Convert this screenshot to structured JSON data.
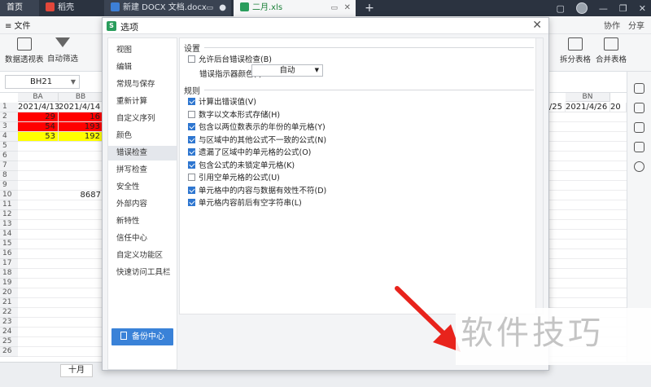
{
  "tabs": {
    "home": "首页",
    "daoke": "稻壳",
    "docx": "新建 DOCX 文档.docx",
    "xls": "二月.xls"
  },
  "menubar": {
    "file": "≡ 文件",
    "collab": "协作",
    "share": "分享"
  },
  "ribbon": {
    "pivot": "数据透视表",
    "autofilter": "自动筛选",
    "split": "拆分表格",
    "merge": "合并表格"
  },
  "formula": {
    "name_box": "BH21"
  },
  "grid": {
    "columns": [
      "BA",
      "BB",
      "BN"
    ],
    "row1": {
      "ba": "2021/4/13",
      "bb": "2021/4/14",
      "partial": "/25",
      "bn": "2021/4/26",
      "edge": "20"
    },
    "row2": {
      "ba": "29",
      "bb": "16"
    },
    "row3": {
      "ba": "54",
      "bb": "193"
    },
    "row4": {
      "ba": "53",
      "bb": "192"
    },
    "row10": {
      "bb": "8687"
    },
    "row_numbers": [
      "1",
      "2",
      "3",
      "4",
      "5",
      "6",
      "7",
      "8",
      "9",
      "10",
      "11",
      "12",
      "13",
      "14",
      "15",
      "16",
      "17",
      "18",
      "19",
      "20",
      "21",
      "22",
      "23",
      "24",
      "25",
      "26"
    ],
    "sheet_tab": "十月"
  },
  "dialog": {
    "title": "选项",
    "nav": [
      "视图",
      "编辑",
      "常规与保存",
      "重新计算",
      "自定义序列",
      "颜色",
      "错误检查",
      "拼写检查",
      "安全性",
      "外部内容",
      "新特性",
      "信任中心",
      "自定义功能区",
      "快速访问工具栏"
    ],
    "active_nav": "错误检查",
    "backup": "备份中心",
    "settings_title": "设置",
    "bg_check": "允许后台错误检查(B)",
    "indicator_color_label": "错误指示器颜色(I):",
    "indicator_color_value": "自动",
    "rules_title": "规则",
    "rules": [
      {
        "label": "计算出错误值(V)",
        "checked": true
      },
      {
        "label": "数字以文本形式存储(H)",
        "checked": false
      },
      {
        "label": "包含以两位数表示的年份的单元格(Y)",
        "checked": true
      },
      {
        "label": "与区域中的其他公式不一致的公式(N)",
        "checked": true
      },
      {
        "label": "遗漏了区域中的单元格的公式(O)",
        "checked": true
      },
      {
        "label": "包含公式的未锁定单元格(K)",
        "checked": true
      },
      {
        "label": "引用空单元格的公式(U)",
        "checked": false
      },
      {
        "label": "单元格中的内容与数据有效性不符(D)",
        "checked": true
      },
      {
        "label": "单元格内容前后有空字符串(L)",
        "checked": true
      }
    ]
  },
  "colors": {
    "red": "#ff0000",
    "yellow": "#ffff00",
    "accent": "#2e76d0"
  },
  "watermark": "软件技巧"
}
